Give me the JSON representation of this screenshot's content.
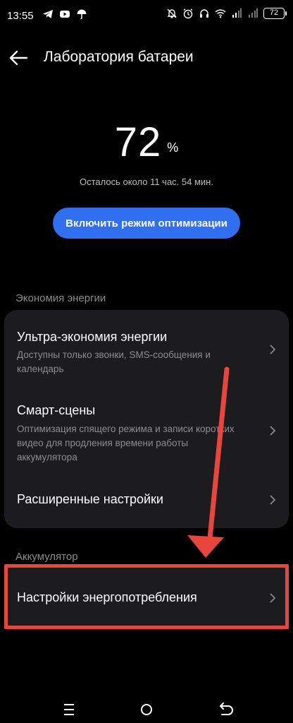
{
  "status_bar": {
    "time": "13:55",
    "left_icons": [
      "telegram-icon",
      "youtube-icon",
      "umbrella-icon"
    ],
    "right_icons": [
      "mute-icon",
      "alarm-icon",
      "headset-icon",
      "wifi-icon",
      "signal-icon",
      "signal-icon-2"
    ],
    "battery": "72"
  },
  "header": {
    "back_icon": "arrow-left-icon",
    "title": "Лаборатория батареи"
  },
  "battery": {
    "percent_value": "72",
    "percent_sign": "%",
    "remaining": "Осталось около 11 час.  54 мин."
  },
  "optimize_button": {
    "label": "Включить режим оптимизации",
    "color": "#2f6ff0"
  },
  "energy_saving": {
    "section_label": "Экономия энергии",
    "items": [
      {
        "title": "Ультра-экономия энергии",
        "subtitle": "Доступны только звонки, SMS-сообщения и календарь"
      },
      {
        "title": "Смарт-сцены",
        "subtitle": "Оптимизация спящего режима и записи коротких видео для продления времени работы аккумулятора"
      },
      {
        "title": "Расширенные настройки",
        "subtitle": ""
      }
    ]
  },
  "accumulator": {
    "section_label": "Аккумулятор",
    "items": [
      {
        "title": "Настройки энергопотребления"
      }
    ]
  },
  "annotation": {
    "color": "#e8453e"
  },
  "nav_bar": {
    "icons": [
      "menu-icon",
      "home-icon",
      "back-icon"
    ]
  }
}
